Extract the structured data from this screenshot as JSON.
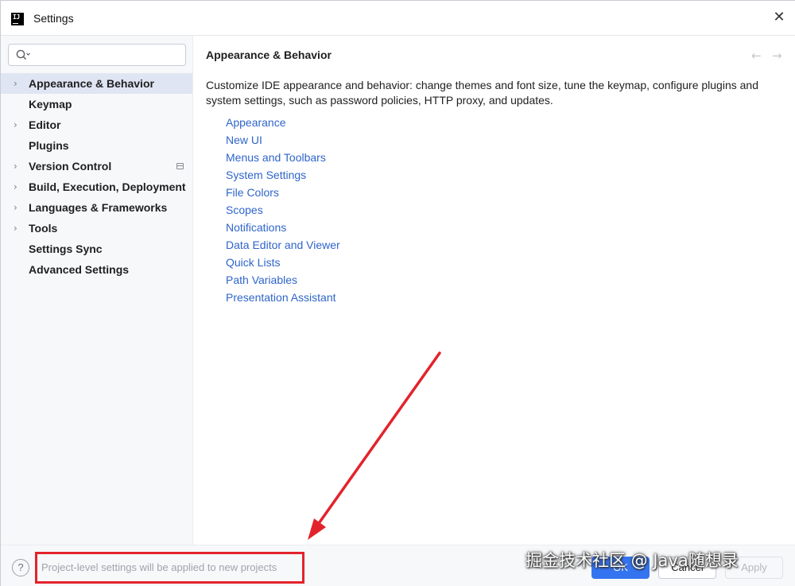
{
  "window": {
    "title": "Settings",
    "close_glyph": "✕",
    "app_logo_text": "IJ"
  },
  "sidebar": {
    "search_placeholder": "",
    "items": [
      {
        "label": "Appearance & Behavior",
        "expandable": true,
        "selected": true
      },
      {
        "label": "Keymap",
        "expandable": false
      },
      {
        "label": "Editor",
        "expandable": true
      },
      {
        "label": "Plugins",
        "expandable": false
      },
      {
        "label": "Version Control",
        "expandable": true,
        "badge": "project-icon"
      },
      {
        "label": "Build, Execution, Deployment",
        "expandable": true
      },
      {
        "label": "Languages & Frameworks",
        "expandable": true
      },
      {
        "label": "Tools",
        "expandable": true
      },
      {
        "label": "Settings Sync",
        "expandable": false
      },
      {
        "label": "Advanced Settings",
        "expandable": false
      }
    ]
  },
  "main": {
    "title": "Appearance & Behavior",
    "back_glyph": "←",
    "forward_glyph": "→",
    "description": "Customize IDE appearance and behavior: change themes and font size, tune the keymap, configure plugins and system settings, such as password policies, HTTP proxy, and updates.",
    "links": [
      "Appearance",
      "New UI",
      "Menus and Toolbars",
      "System Settings",
      "File Colors",
      "Scopes",
      "Notifications",
      "Data Editor and Viewer",
      "Quick Lists",
      "Path Variables",
      "Presentation Assistant"
    ]
  },
  "footer": {
    "help_glyph": "?",
    "project_note": "Project-level settings will be applied to new projects",
    "ok_label": "OK",
    "cancel_label": "Cancel",
    "apply_label": "Apply"
  },
  "annotation": {
    "color": "#e3232b"
  },
  "watermark": {
    "text": "掘金技术社区 @ Java随想录"
  },
  "colors": {
    "accent": "#3574f0",
    "link": "#2f65ca",
    "selection": "#dfe5f3"
  }
}
